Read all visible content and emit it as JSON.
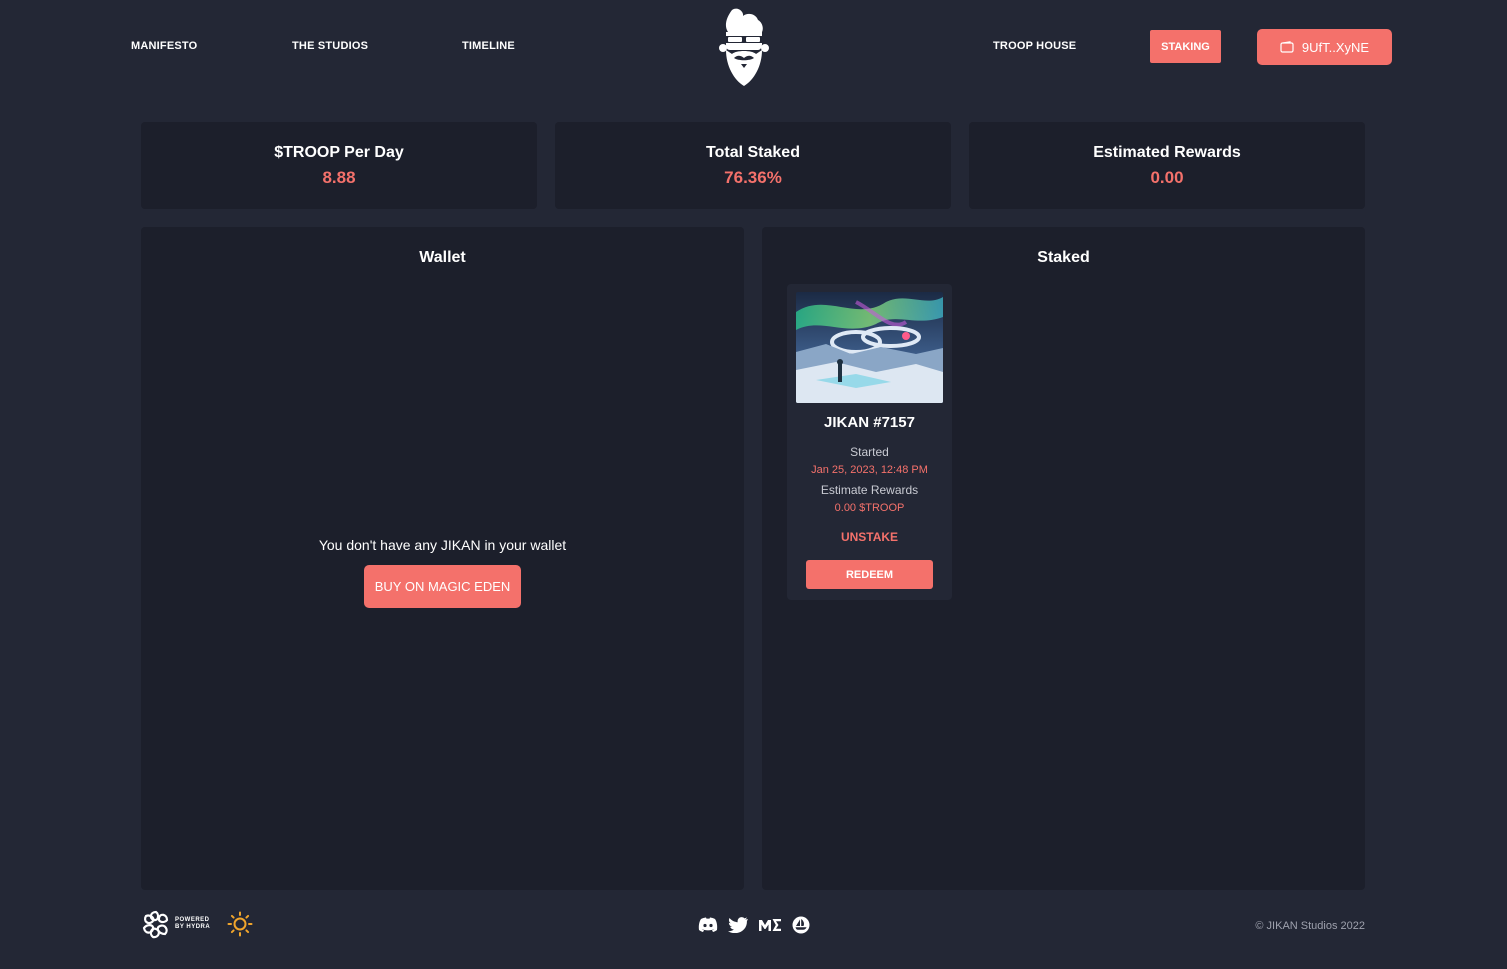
{
  "nav": {
    "left_links": [
      "MANIFESTO",
      "THE STUDIOS",
      "TIMELINE"
    ],
    "troop_house": "TROOP HOUSE",
    "staking": "STAKING",
    "wallet_address": "9UfT..XyNE"
  },
  "stats": [
    {
      "label": "$TROOP Per Day",
      "value": "8.88"
    },
    {
      "label": "Total Staked",
      "value": "76.36%"
    },
    {
      "label": "Estimated Rewards",
      "value": "0.00"
    }
  ],
  "wallet": {
    "title": "Wallet",
    "empty_message": "You don't have any JIKAN in your wallet",
    "buy_button": "BUY ON MAGIC EDEN"
  },
  "staked": {
    "title": "Staked",
    "items": [
      {
        "name": "JIKAN #7157",
        "started_label": "Started",
        "started_value": "Jan 25, 2023, 12:48 PM",
        "rewards_label": "Estimate Rewards",
        "rewards_value": "0.00 $TROOP",
        "unstake": "UNSTAKE",
        "redeem": "REDEEM"
      }
    ]
  },
  "footer": {
    "powered_line1": "POWERED",
    "powered_line2": "BY HYDRA",
    "socials": [
      "discord-icon",
      "twitter-icon",
      "magic-eden-icon",
      "opensea-icon"
    ],
    "copyright": "© JIKAN Studios 2022"
  },
  "colors": {
    "background": "#232735",
    "card": "#1c1f2b",
    "accent": "#f4716b"
  }
}
